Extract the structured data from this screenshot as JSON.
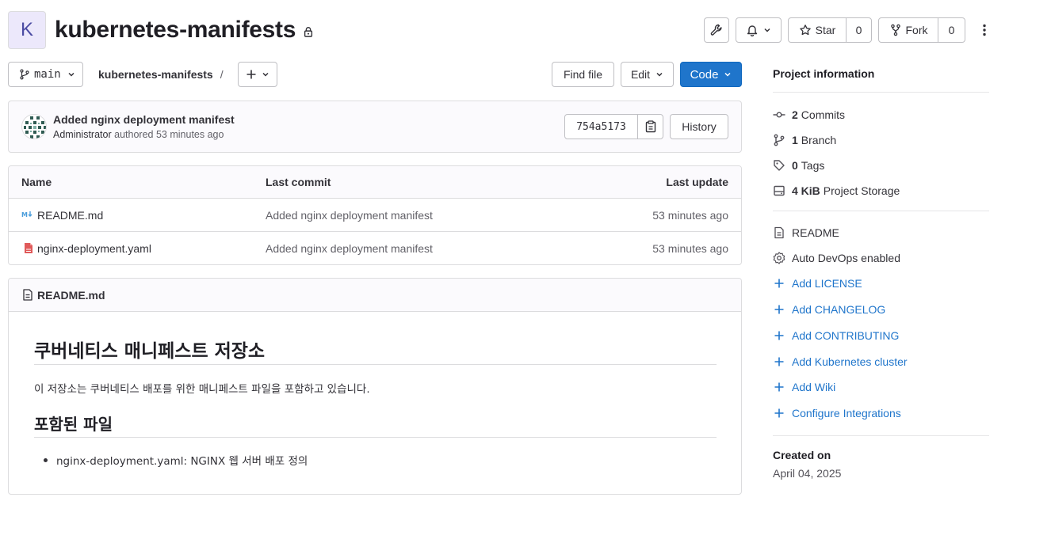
{
  "project": {
    "avatar_letter": "K",
    "name": "kubernetes-manifests"
  },
  "header_actions": {
    "star_label": "Star",
    "star_count": "0",
    "fork_label": "Fork",
    "fork_count": "0"
  },
  "toolbar": {
    "branch": "main",
    "breadcrumb_project": "kubernetes-manifests",
    "breadcrumb_sep": "/",
    "find_file": "Find file",
    "edit": "Edit",
    "code": "Code"
  },
  "last_commit": {
    "title": "Added nginx deployment manifest",
    "author": "Administrator",
    "authored_text": "authored",
    "time": "53 minutes ago",
    "sha": "754a5173",
    "history": "History"
  },
  "file_table": {
    "headers": {
      "name": "Name",
      "last_commit": "Last commit",
      "last_update": "Last update"
    },
    "rows": [
      {
        "name": "README.md",
        "commit": "Added nginx deployment manifest",
        "updated": "53 minutes ago",
        "icon": "markdown-icon"
      },
      {
        "name": "nginx-deployment.yaml",
        "commit": "Added nginx deployment manifest",
        "updated": "53 minutes ago",
        "icon": "yaml-file-icon"
      }
    ]
  },
  "readme": {
    "filename": "README.md",
    "h1": "쿠버네티스 매니페스트 저장소",
    "intro": "이 저장소는 쿠버네티스 배포를 위한 매니페스트 파일을 포함하고 있습니다.",
    "h2": "포함된 파일",
    "items": [
      "nginx-deployment.yaml: NGINX 웹 서버 배포 정의"
    ]
  },
  "sidebar": {
    "title": "Project information",
    "stats": [
      {
        "count": "2",
        "label": "Commits",
        "icon": "commit-icon"
      },
      {
        "count": "1",
        "label": "Branch",
        "icon": "branch-icon"
      },
      {
        "count": "0",
        "label": "Tags",
        "icon": "tag-icon"
      },
      {
        "count": "4 KiB",
        "label": "Project Storage",
        "icon": "storage-icon"
      }
    ],
    "readme_label": "README",
    "autodevops_label": "Auto DevOps enabled",
    "add_links": [
      "Add LICENSE",
      "Add CHANGELOG",
      "Add CONTRIBUTING",
      "Add Kubernetes cluster",
      "Add Wiki",
      "Configure Integrations"
    ],
    "created_on_label": "Created on",
    "created_on_value": "April 04, 2025"
  }
}
